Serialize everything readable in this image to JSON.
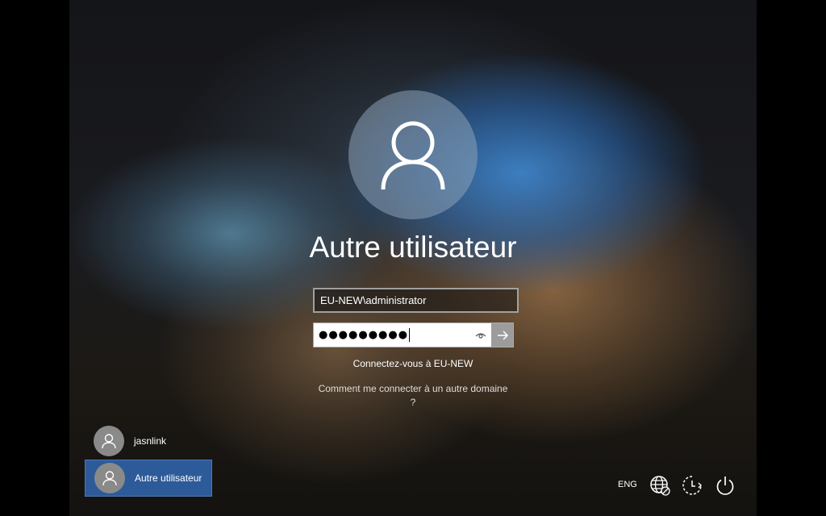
{
  "login": {
    "user_title": "Autre utilisateur",
    "username_value": "EU-NEW\\administrator",
    "password_mask": "●●●●●●●●●",
    "domain_link": "Connectez-vous à EU-NEW",
    "help_link": "Comment me connecter à un autre domaine ?"
  },
  "users": [
    {
      "label": "jasnlink",
      "selected": false
    },
    {
      "label": "Autre utilisateur",
      "selected": true
    }
  ],
  "tray": {
    "language": "ENG",
    "icons": [
      "network-icon",
      "ease-of-access-icon",
      "power-icon"
    ]
  },
  "colors": {
    "selected_user_bg": "#2d5b9a",
    "submit_button_bg": "#9c9c9c"
  }
}
